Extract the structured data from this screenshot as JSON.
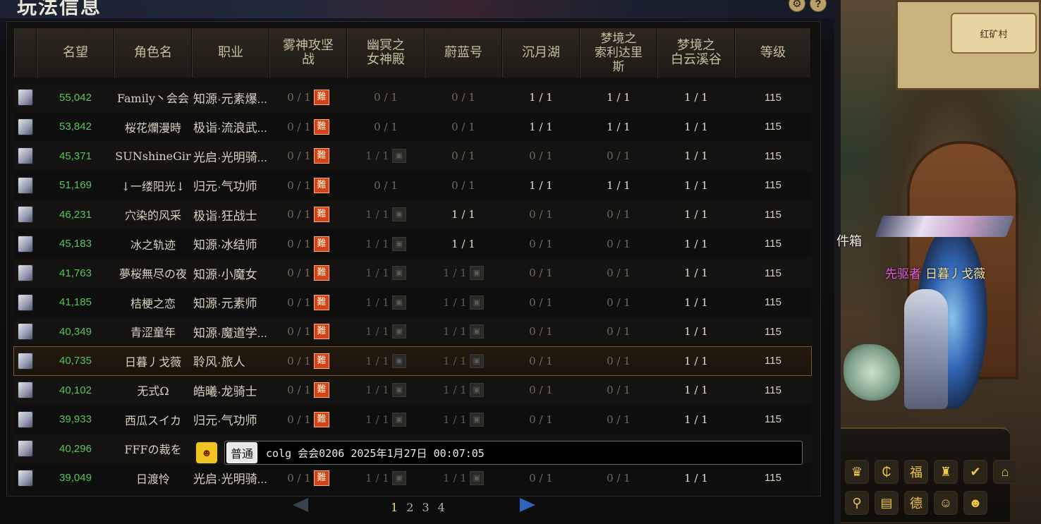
{
  "panel": {
    "title": "玩法信息",
    "header_icons": [
      "gear-icon",
      "help-icon"
    ],
    "help_glyph": "?",
    "gear_glyph": "⚙"
  },
  "columns": [
    "名望",
    "角色名",
    "职业",
    "雾神攻坚战",
    "幽冥之女神殿",
    "蔚蓝号",
    "沉月湖",
    "梦境之索利达里斯",
    "梦境之白云溪谷",
    "等级"
  ],
  "column_display": [
    "名望",
    "角色名",
    "职业",
    "雾神攻坚\n战",
    "幽冥之\n女神殿",
    "蔚蓝号",
    "沉月湖",
    "梦境之\n索利达里\n斯",
    "梦境之\n白云溪谷",
    "等级"
  ],
  "hard_badge": "難",
  "lock_glyph": "🔒",
  "rows": [
    {
      "fame": "55,042",
      "name": "Family丶会会",
      "job": "知源·元素爆...",
      "s": [
        "0 / 1|hard",
        "0 / 1|zero",
        "0 / 1|zero",
        "1 / 1|done",
        "1 / 1|done",
        "1 / 1|done"
      ],
      "level": "115"
    },
    {
      "fame": "53,842",
      "name": "桜花爛漫時",
      "job": "极诣·流浪武...",
      "s": [
        "0 / 1|hard",
        "0 / 1|zero",
        "0 / 1|zero",
        "1 / 1|done",
        "1 / 1|done",
        "1 / 1|done"
      ],
      "level": "115"
    },
    {
      "fame": "45,371",
      "name": "SUNshineGir",
      "job": "光启·光明骑...",
      "s": [
        "0 / 1|hard",
        "1 / 1|lock",
        "0 / 1|zero",
        "0 / 1|zero",
        "0 / 1|zero",
        "1 / 1|done"
      ],
      "level": "115"
    },
    {
      "fame": "51,169",
      "name": "↓一缕阳光↓",
      "job": "归元·气功师",
      "s": [
        "0 / 1|hard",
        "0 / 1|zero",
        "0 / 1|zero",
        "1 / 1|done",
        "1 / 1|done",
        "1 / 1|done"
      ],
      "level": "115"
    },
    {
      "fame": "46,231",
      "name": "穴染的风采",
      "job": "极诣·狂战士",
      "s": [
        "0 / 1|hard",
        "1 / 1|lock",
        "1 / 1|done",
        "0 / 1|zero",
        "0 / 1|zero",
        "1 / 1|done"
      ],
      "level": "115"
    },
    {
      "fame": "45,183",
      "name": "冰之轨迹",
      "job": "知源·冰结师",
      "s": [
        "0 / 1|hard",
        "1 / 1|lock",
        "1 / 1|done",
        "0 / 1|zero",
        "0 / 1|zero",
        "1 / 1|done"
      ],
      "level": "115"
    },
    {
      "fame": "41,763",
      "name": "夢桜無尽の夜",
      "job": "知源·小魔女",
      "s": [
        "0 / 1|hard",
        "1 / 1|lock",
        "1 / 1|lock",
        "0 / 1|zero",
        "0 / 1|zero",
        "1 / 1|done"
      ],
      "level": "115"
    },
    {
      "fame": "41,185",
      "name": "桔梗之恋",
      "job": "知源·元素师",
      "s": [
        "0 / 1|hard",
        "1 / 1|lock",
        "1 / 1|lock",
        "0 / 1|zero",
        "0 / 1|zero",
        "1 / 1|done"
      ],
      "level": "115"
    },
    {
      "fame": "40,349",
      "name": "青涩童年",
      "job": "知源·魔道学...",
      "s": [
        "0 / 1|hard",
        "1 / 1|lock",
        "1 / 1|lock",
        "0 / 1|zero",
        "0 / 1|zero",
        "1 / 1|done"
      ],
      "level": "115"
    },
    {
      "fame": "40,735",
      "name": "日暮丿戈薇",
      "job": "聆风·旅人",
      "s": [
        "0 / 1|hard",
        "1 / 1|lock",
        "1 / 1|lock",
        "0 / 1|zero",
        "0 / 1|zero",
        "1 / 1|done"
      ],
      "level": "115",
      "selected": true
    },
    {
      "fame": "40,102",
      "name": "无式Ω",
      "job": "皓曦·龙骑士",
      "s": [
        "0 / 1|hard",
        "1 / 1|lock",
        "1 / 1|lock",
        "0 / 1|zero",
        "0 / 1|zero",
        "1 / 1|done"
      ],
      "level": "115"
    },
    {
      "fame": "39,933",
      "name": "西瓜スイカ",
      "job": "归元·气功师",
      "s": [
        "0 / 1|hard",
        "1 / 1|lock",
        "1 / 1|lock",
        "0 / 1|zero",
        "0 / 1|zero",
        "1 / 1|done"
      ],
      "level": "115"
    },
    {
      "fame": "40,296",
      "name": "FFFの裁を",
      "job": "",
      "s": [
        "",
        "",
        "",
        "",
        "",
        ""
      ],
      "level": "",
      "obscured": true
    },
    {
      "fame": "39,049",
      "name": "日渡怜",
      "job": "光启·光明骑...",
      "s": [
        "0 / 1|hard",
        "1 / 1|lock",
        "1 / 1|lock",
        "0 / 1|zero",
        "0 / 1|zero",
        "1 / 1|done"
      ],
      "level": "115"
    }
  ],
  "pagination": {
    "pages": [
      "1",
      "2",
      "3",
      "4"
    ],
    "active": "1"
  },
  "chat": {
    "channel": "普通",
    "text": "colg 会会0206 2025年1月27日 00:07:05"
  },
  "scene": {
    "minimap_label": "红矿村",
    "side_text": "件箱",
    "title_prefix": "先驱者",
    "character_name": "日暮丿戈薇",
    "hud_row1": [
      "crown-icon",
      "coin-icon",
      "lucky-bag-icon",
      "trophy-icon",
      "checklist-icon",
      "home-icon"
    ],
    "hud_row2": [
      "map-pin-icon",
      "book-icon",
      "guild-icon",
      "avatar-red-icon",
      "avatar-pink-icon"
    ],
    "hud_glyphs1": [
      "♛",
      "₵",
      "福",
      "♜",
      "✔",
      "⌂"
    ],
    "hud_glyphs2": [
      "⚲",
      "▤",
      "德",
      "☺",
      "☻"
    ]
  }
}
